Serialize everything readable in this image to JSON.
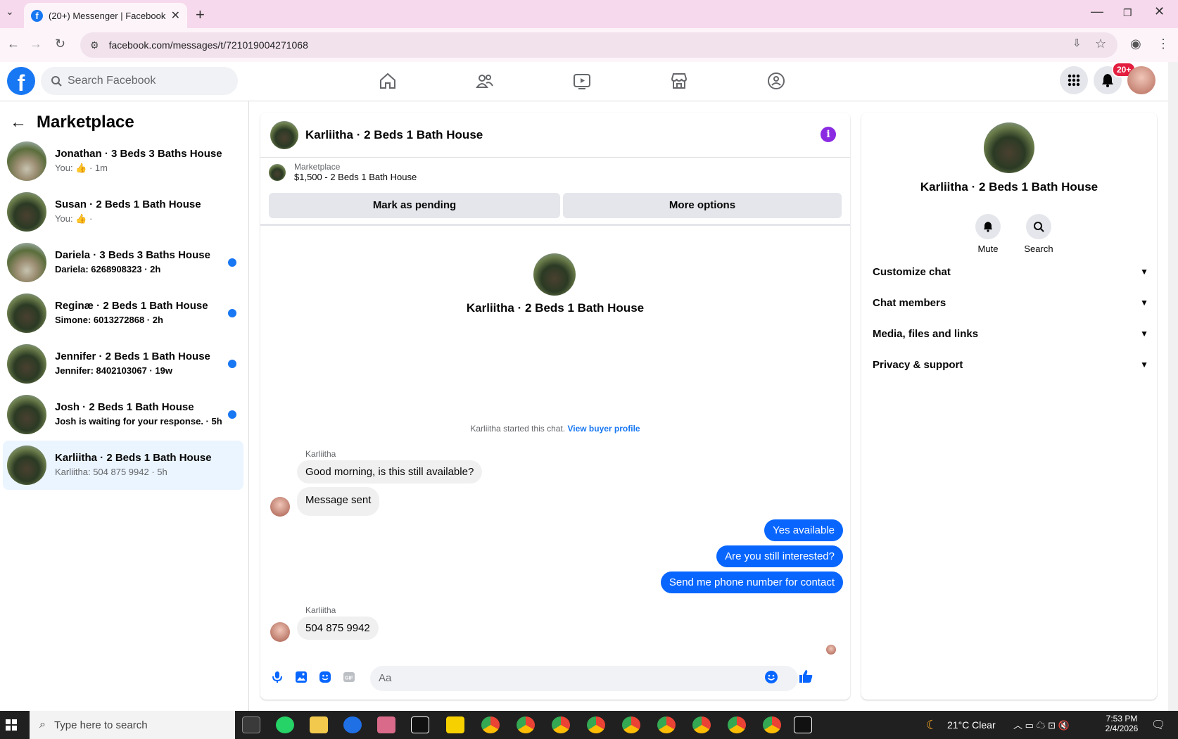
{
  "browser": {
    "tab_title": "(20+) Messenger | Facebook",
    "url": "facebook.com/messages/t/721019004271068"
  },
  "facebook": {
    "search_placeholder": "Search Facebook",
    "notif_badge": "20+"
  },
  "left": {
    "title": "Marketplace",
    "conversations": [
      {
        "title": "Jonathan · 3 Beds 3 Baths House",
        "snippet": "You: 👍 · 1m",
        "unread": false
      },
      {
        "title": "Susan · 2 Beds 1 Bath House",
        "snippet": "You: 👍 ·",
        "unread": false
      },
      {
        "title": "Dariela · 3 Beds 3 Baths House",
        "snippet": "Dariela: 6268908323 · 2h",
        "unread": true
      },
      {
        "title": "Reginæ · 2 Beds 1 Bath House",
        "snippet": "Simone: 6013272868 · 2h",
        "unread": true
      },
      {
        "title": "Jennifer · 2 Beds 1 Bath House",
        "snippet": "Jennifer: 8402103067 · 19w",
        "unread": true
      },
      {
        "title": "Josh · 2 Beds 1 Bath House",
        "snippet": "Josh is waiting for your response. · 5h",
        "unread": true
      },
      {
        "title": "Karliitha · 2 Beds 1 Bath House",
        "snippet": "Karliitha: 504 875 9942 · 5h",
        "unread": false
      }
    ]
  },
  "chat": {
    "header_name": "Karliitha · 2 Beds 1 Bath House",
    "marketplace_label": "Marketplace",
    "listing": "$1,500 - 2 Beds 1 Bath House",
    "mark_pending": "Mark as pending",
    "more_options": "More options",
    "center_name": "Karliitha · 2 Beds 1 Bath House",
    "started_text": "Karliitha started this chat.",
    "view_buyer": "View buyer profile",
    "sender1": "Karliitha",
    "msg1": "Good morning, is this still available?",
    "msg2": "Message sent",
    "out1": "Yes available",
    "out2": "Are you still interested?",
    "out3": "Send me phone number for contact",
    "sender2": "Karliitha",
    "msg3": "504 875 9942",
    "composer_placeholder": "Aa"
  },
  "info": {
    "name": "Karliitha · 2 Beds 1 Bath House",
    "mute": "Mute",
    "search": "Search",
    "rows": [
      "Customize chat",
      "Chat members",
      "Media, files and links",
      "Privacy & support"
    ]
  },
  "taskbar": {
    "search": "Type here to search",
    "weather": "21°C  Clear",
    "time": "7:53 PM",
    "date": "2/4/2026"
  }
}
